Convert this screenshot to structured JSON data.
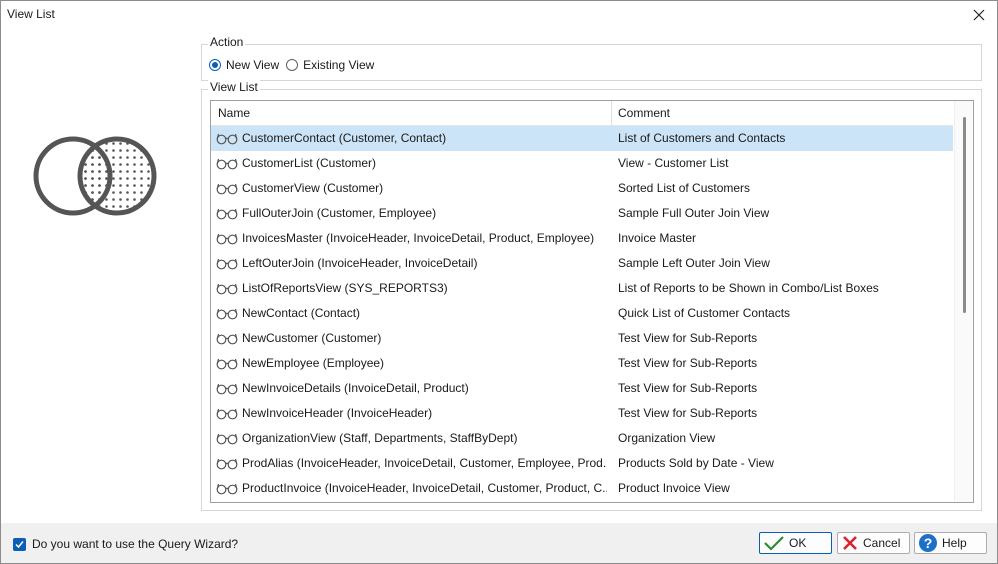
{
  "window": {
    "title": "View List"
  },
  "action": {
    "label": "Action",
    "options": [
      {
        "label": "New View",
        "checked": true
      },
      {
        "label": "Existing View",
        "checked": false
      }
    ]
  },
  "view_list": {
    "label": "View List",
    "columns": [
      "Name",
      "Comment"
    ],
    "selected_index": 0,
    "rows": [
      {
        "name": "CustomerContact (Customer, Contact)",
        "comment": "List of Customers and Contacts"
      },
      {
        "name": "CustomerList (Customer)",
        "comment": "View - Customer List"
      },
      {
        "name": "CustomerView (Customer)",
        "comment": "Sorted List of Customers"
      },
      {
        "name": "FullOuterJoin (Customer, Employee)",
        "comment": "Sample Full Outer Join View"
      },
      {
        "name": "InvoicesMaster (InvoiceHeader, InvoiceDetail, Product, Employee)",
        "comment": "Invoice Master"
      },
      {
        "name": "LeftOuterJoin (InvoiceHeader, InvoiceDetail)",
        "comment": "Sample Left Outer Join View"
      },
      {
        "name": "ListOfReportsView (SYS_REPORTS3)",
        "comment": "List of Reports to be Shown in Combo/List Boxes"
      },
      {
        "name": "NewContact (Contact)",
        "comment": "Quick List of Customer Contacts"
      },
      {
        "name": "NewCustomer (Customer)",
        "comment": "Test View for Sub-Reports"
      },
      {
        "name": "NewEmployee (Employee)",
        "comment": "Test View for Sub-Reports"
      },
      {
        "name": "NewInvoiceDetails (InvoiceDetail, Product)",
        "comment": "Test View for Sub-Reports"
      },
      {
        "name": "NewInvoiceHeader (InvoiceHeader)",
        "comment": "Test View for Sub-Reports"
      },
      {
        "name": "OrganizationView (Staff, Departments, StaffByDept)",
        "comment": "Organization View"
      },
      {
        "name": "ProdAlias (InvoiceHeader, InvoiceDetail, Customer, Employee, Prod...",
        "comment": "Products Sold by Date - View"
      },
      {
        "name": "ProductInvoice (InvoiceHeader, InvoiceDetail, Customer, Product, C...",
        "comment": "Product Invoice View"
      }
    ]
  },
  "footer": {
    "wizard_label": "Do you want to use the Query Wizard?",
    "wizard_checked": true,
    "ok_label": "OK",
    "cancel_label": "Cancel",
    "help_label": "Help"
  },
  "colors": {
    "accent": "#0a5fb4",
    "selection": "#cce4f7",
    "cancel_icon": "#d9232e",
    "ok_icon": "#2e8b2e"
  },
  "icons": {
    "row": "glasses-icon",
    "logo": "venn-diagram-icon",
    "close": "close-icon",
    "ok": "checkmark-icon",
    "cancel": "x-icon",
    "help": "help-icon"
  }
}
